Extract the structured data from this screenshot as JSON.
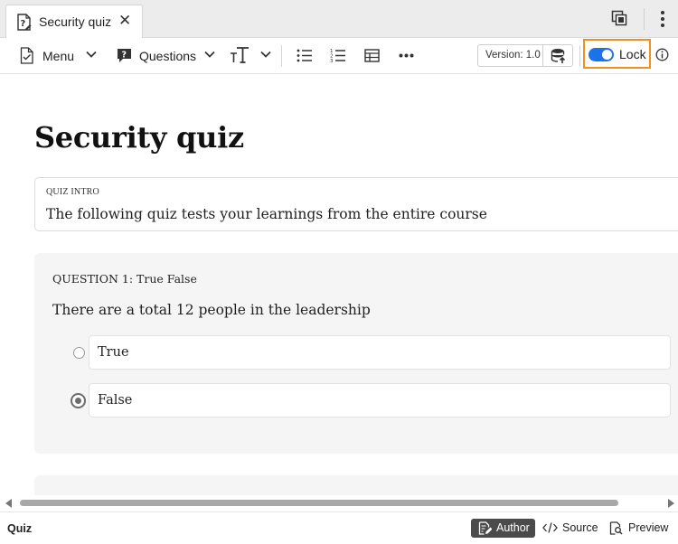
{
  "tab": {
    "title": "Security quiz",
    "close_glyph": "✕",
    "icon": "quiz-doc-icon"
  },
  "toolbar": {
    "menu_label": "Menu",
    "questions_label": "Questions",
    "version_label": "Version: 1.0",
    "lock_label": "Lock",
    "lock_enabled": true,
    "icons": [
      "document-check-icon",
      "chevron-down-icon",
      "question-bubble-icon",
      "text-size-icon",
      "bulleted-list-icon",
      "numbered-list-icon",
      "table-icon",
      "more-horizontal-icon",
      "database-upload-icon",
      "info-icon",
      "pages-icon",
      "more-vertical-icon"
    ]
  },
  "content": {
    "title": "Security quiz",
    "intro": {
      "label": "QUIZ INTRO",
      "text": "The following quiz tests your learnings from the entire course"
    },
    "question": {
      "label": "QUESTION 1: True False",
      "text": "There are a total 12 people in the leadership",
      "options": [
        {
          "label": "True",
          "selected": false
        },
        {
          "label": "False",
          "selected": true
        }
      ]
    }
  },
  "statusbar": {
    "label": "Quiz",
    "modes": {
      "author": "Author",
      "source": "Source",
      "preview": "Preview"
    },
    "active_mode": "Author"
  },
  "colors": {
    "accent": "#1a73e8",
    "highlight_border": "#f0901e",
    "active_mode_bg": "#4b4b4b",
    "card_bg": "#f5f5f5"
  }
}
